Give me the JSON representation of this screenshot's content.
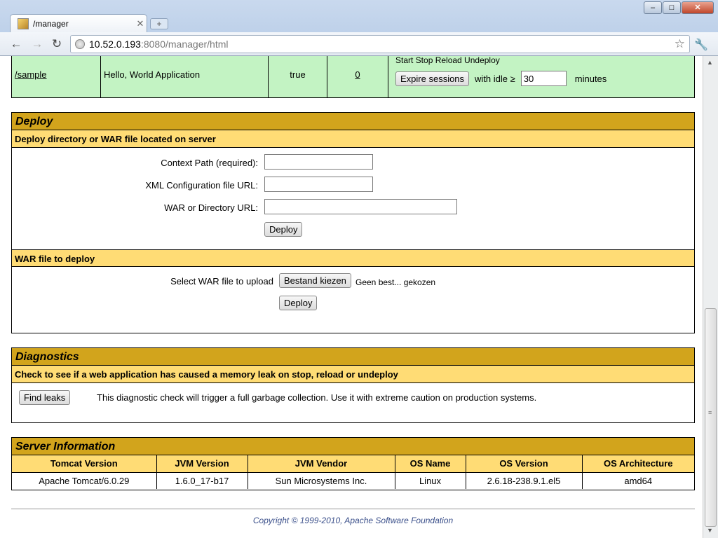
{
  "browser": {
    "tab_title": "/manager",
    "tab_close": "✕",
    "new_tab": "+",
    "url_host": "10.52.0.193",
    "url_rest": ":8080/manager/html",
    "win_min": "–",
    "win_max": "□",
    "win_close": "✕"
  },
  "applications": {
    "row": {
      "path": "/sample",
      "display_name": "Hello, World Application",
      "running": "true",
      "sessions": "0",
      "commands_partial": "Start  Stop  Reload  Undeploy",
      "expire_label": "Expire sessions",
      "idle_label": "with idle ≥",
      "idle_value": "30",
      "minutes_label": "minutes"
    }
  },
  "deploy": {
    "title": "Deploy",
    "server_sub": "Deploy directory or WAR file located on server",
    "context_label": "Context Path (required):",
    "xml_label": "XML Configuration file URL:",
    "war_label": "WAR or Directory URL:",
    "deploy_btn": "Deploy",
    "upload_sub": "WAR file to deploy",
    "select_label": "Select WAR file to upload",
    "choose_btn": "Bestand kiezen",
    "no_file": "Geen best... gekozen",
    "deploy_btn2": "Deploy"
  },
  "diagnostics": {
    "title": "Diagnostics",
    "sub": "Check to see if a web application has caused a memory leak on stop, reload or undeploy",
    "find_btn": "Find leaks",
    "desc": "This diagnostic check will trigger a full garbage collection. Use it with extreme caution on production systems."
  },
  "server_info": {
    "title": "Server Information",
    "headers": [
      "Tomcat Version",
      "JVM Version",
      "JVM Vendor",
      "OS Name",
      "OS Version",
      "OS Architecture"
    ],
    "values": [
      "Apache Tomcat/6.0.29",
      "1.6.0_17-b17",
      "Sun Microsystems Inc.",
      "Linux",
      "2.6.18-238.9.1.el5",
      "amd64"
    ]
  },
  "footer": "Copyright © 1999-2010, Apache Software Foundation"
}
